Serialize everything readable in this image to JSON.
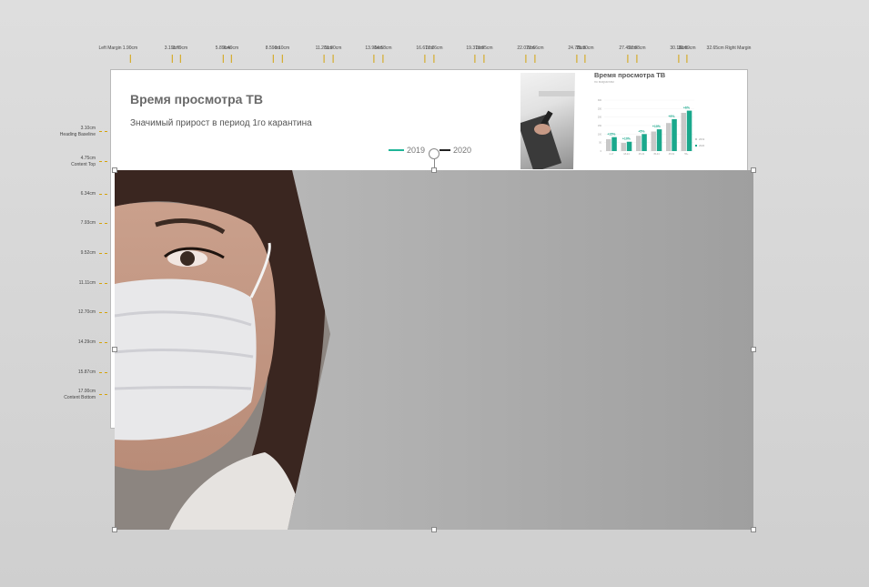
{
  "ruler": {
    "top_markers": [
      "Left Margin",
      "1.90cm",
      "3.19cm",
      "3.79cm",
      "5.89cm",
      "6.49cm",
      "8.59cm",
      "9.10cm",
      "11.28cm",
      "11.90cm",
      "13.98cm",
      "14.58cm",
      "16.67cm",
      "17.26cm",
      "19.37cm",
      "19.95cm",
      "22.07cm",
      "22.66cm",
      "24.76cm",
      "25.30cm",
      "27.45cm",
      "27.98cm",
      "30.16cm",
      "30.69cm",
      "32.65cm Right Margin"
    ],
    "left_markers": [
      "3.10cm\nHeading Baseline",
      "4.75cm\nContent Top",
      "6.34cm",
      "7.93cm",
      "9.52cm",
      "11.11cm",
      "12.70cm",
      "14.29cm",
      "15.87cm",
      "17.00cm\nContent Bottom"
    ]
  },
  "slide": {
    "title": "Время просмотра ТВ",
    "subtitle": "Значимый прирост в период 1го карантина",
    "legend": [
      {
        "label": "2019",
        "color": "#1fb597"
      },
      {
        "label": "2020",
        "color": "#222222"
      }
    ]
  },
  "thumbnail": {
    "title": "Время просмотра ТВ",
    "subtitle": "по возрастам",
    "legend": [
      "2019",
      "2020"
    ]
  },
  "chart_data": {
    "type": "bar",
    "categories": [
      "4-17",
      "18-24",
      "25-34",
      "35-44",
      "45-54",
      "55+"
    ],
    "series": [
      {
        "name": "2019",
        "color": "#c8c8c8",
        "values": [
          70,
          48,
          90,
          115,
          165,
          225
        ]
      },
      {
        "name": "2020",
        "color": "#1aa88c",
        "values": [
          82,
          55,
          100,
          128,
          188,
          238
        ]
      }
    ],
    "annotations": [
      "+15%",
      "+10%",
      "+5%",
      "+10%",
      "+9%",
      "+6%"
    ],
    "ylim": [
      0,
      300
    ]
  },
  "colors": {
    "accent": "#1fb597",
    "canvas": "#d4d4d4",
    "picture_gray": "#a6a6a6"
  }
}
